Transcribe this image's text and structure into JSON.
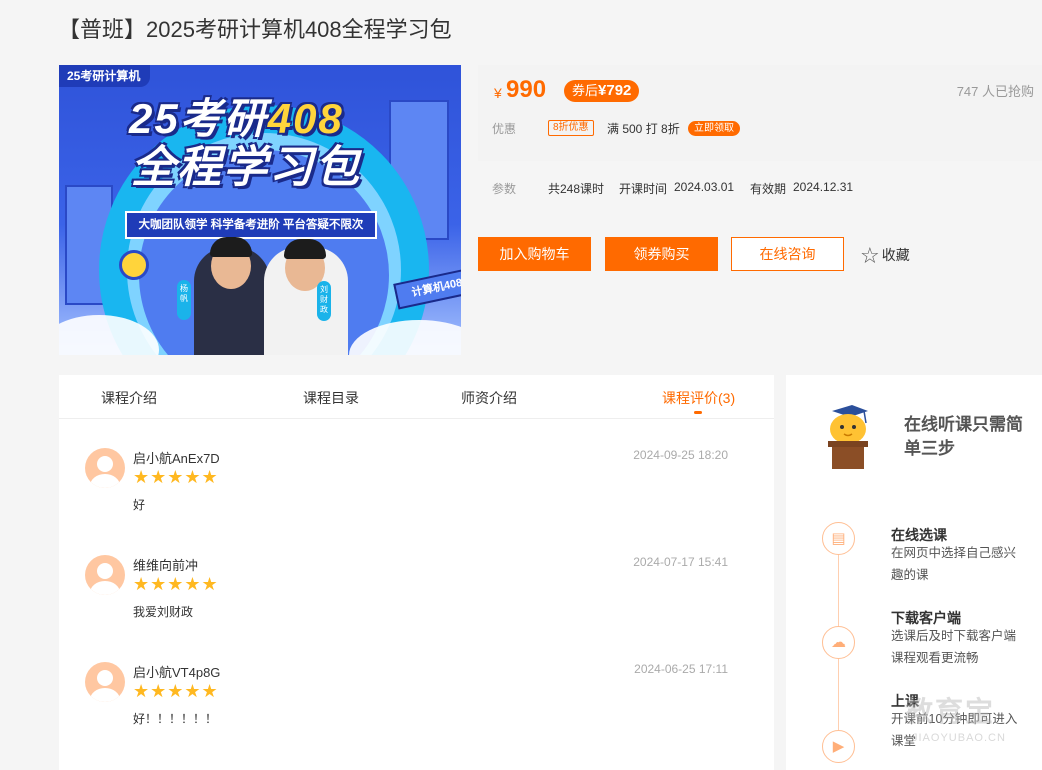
{
  "course": {
    "title": "【普班】2025考研计算机408全程学习包",
    "banner": {
      "corner_tag": "25考研计算机",
      "headline_1a": "25考研",
      "headline_1b": "408",
      "headline_2": "全程学习包",
      "slogan": "大咖团队领学  科学备考进阶  平台答疑不限次",
      "sign": "计算机408",
      "teacher_1": "杨帆",
      "teacher_2": "刘财政"
    }
  },
  "pricing": {
    "currency": "¥",
    "price": "990",
    "coupon_prefix": "券后",
    "coupon_price": "¥792",
    "buyers": "747 人已抢购",
    "promo_label": "优惠",
    "promo_tag": "8折优惠",
    "promo_text": "满 500 打 8折",
    "promo_button": "立即领取"
  },
  "params": {
    "label": "参数",
    "lessons": "共248课时",
    "start_label": "开课时间",
    "start_date": "2024.03.01",
    "valid_label": "有效期",
    "valid_date": "2024.12.31"
  },
  "actions": {
    "add_cart": "加入购物车",
    "coupon_buy": "领券购买",
    "consult": "在线咨询",
    "favorite": "收藏"
  },
  "tabs": [
    {
      "label": "课程介绍"
    },
    {
      "label": "课程目录"
    },
    {
      "label": "师资介绍"
    },
    {
      "label": "课程评价(3)",
      "active": true
    }
  ],
  "reviews": [
    {
      "name": "启小航AnEx7D",
      "date": "2024-09-25 18:20",
      "rating": 5,
      "text": "好"
    },
    {
      "name": "维维向前冲",
      "date": "2024-07-17 15:41",
      "rating": 5,
      "text": "我爱刘财政"
    },
    {
      "name": "启小航VT4p8G",
      "date": "2024-06-25 17:11",
      "rating": 5,
      "text": "好！！！！！！"
    }
  ],
  "sidebar": {
    "title": "在线听课只需简单三步",
    "steps": [
      {
        "title": "在线选课",
        "desc": "在网页中选择自己感兴趣的课",
        "icon": "course-icon"
      },
      {
        "title": "下载客户端",
        "desc": "选课后及时下载客户端 课程观看更流畅",
        "icon": "cloud-download-icon"
      },
      {
        "title": "上课",
        "desc": "开课前10分钟即可进入课堂",
        "icon": "video-camera-icon"
      }
    ]
  },
  "watermark": {
    "main": "教育宝",
    "sub": "JIAOYUBAO.CN"
  },
  "colors": {
    "accent": "#ff6a00",
    "star": "#ffb820",
    "avatar": "#ffc7a1"
  }
}
